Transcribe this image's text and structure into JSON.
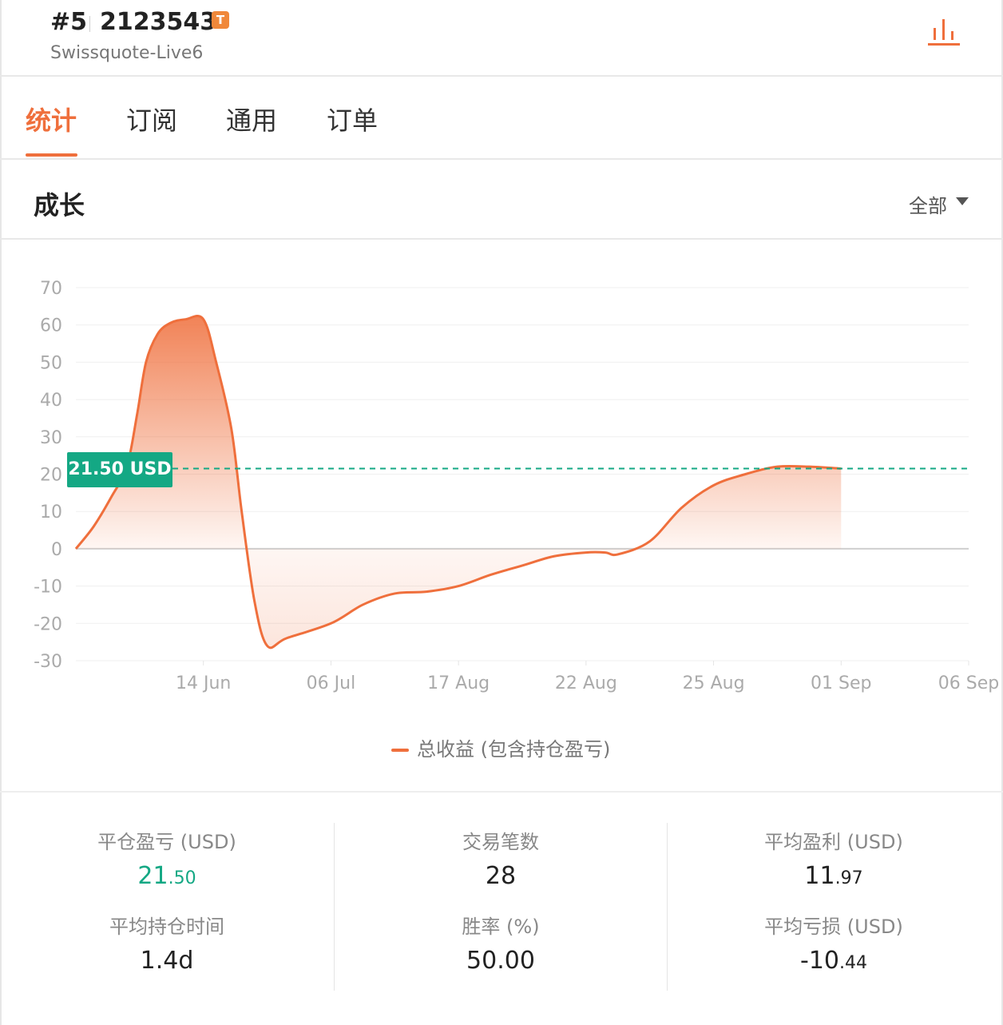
{
  "header": {
    "rank": "#5",
    "account_id": "2123543",
    "badge": "T",
    "server": "Swissquote-Live6",
    "icon": "bar-chart-icon"
  },
  "tabs": [
    {
      "label": "统计",
      "active": true
    },
    {
      "label": "订阅",
      "active": false
    },
    {
      "label": "通用",
      "active": false
    },
    {
      "label": "订单",
      "active": false
    }
  ],
  "section": {
    "title": "成长",
    "filter_label": "全部"
  },
  "colors": {
    "accent": "#ef6f3c",
    "positive": "#14a884"
  },
  "chart_data": {
    "type": "area",
    "series": [
      {
        "name": "总收益 (包含持仓盈亏)",
        "points": [
          [
            0,
            0
          ],
          [
            0.14,
            6
          ],
          [
            0.28,
            14
          ],
          [
            0.4,
            22
          ],
          [
            0.48,
            36
          ],
          [
            0.55,
            50
          ],
          [
            0.64,
            57.5
          ],
          [
            0.74,
            60.5
          ],
          [
            0.86,
            61.5
          ],
          [
            1.0,
            61.5
          ],
          [
            1.1,
            50
          ],
          [
            1.22,
            32
          ],
          [
            1.3,
            10
          ],
          [
            1.4,
            -14
          ],
          [
            1.5,
            -26
          ],
          [
            1.65,
            -24
          ],
          [
            2.0,
            -20
          ],
          [
            2.25,
            -15
          ],
          [
            2.5,
            -12
          ],
          [
            2.75,
            -11.5
          ],
          [
            3.0,
            -10
          ],
          [
            3.25,
            -7
          ],
          [
            3.5,
            -4.5
          ],
          [
            3.75,
            -2
          ],
          [
            4.0,
            -1
          ],
          [
            4.15,
            -1
          ],
          [
            4.25,
            -1.5
          ],
          [
            4.5,
            2
          ],
          [
            4.75,
            11
          ],
          [
            5.0,
            17
          ],
          [
            5.25,
            20
          ],
          [
            5.5,
            22
          ],
          [
            5.75,
            22
          ],
          [
            6.0,
            21.5
          ]
        ]
      }
    ],
    "x_tick_labels": [
      "14 Jun",
      "06 Jul",
      "17 Aug",
      "22 Aug",
      "25 Aug",
      "01 Sep",
      "06 Sep"
    ],
    "y_ticks": [
      70,
      60,
      50,
      40,
      30,
      20,
      10,
      0,
      -10,
      -20,
      -30
    ],
    "ylim": [
      -30,
      70
    ],
    "current_value": 21.5,
    "current_label": "21.50 USD",
    "grid": true,
    "legend_position": "bottom-center"
  },
  "stats": {
    "closed_pnl": {
      "label": "平仓盈亏 (USD)",
      "int": "21",
      "dec": ".50"
    },
    "trades": {
      "label": "交易笔数",
      "value": "28"
    },
    "avg_profit": {
      "label": "平均盈利 (USD)",
      "int": "11",
      "dec": ".97"
    },
    "avg_hold": {
      "label": "平均持仓时间",
      "value": "1.4d"
    },
    "win_rate": {
      "label": "胜率 (%)",
      "value": "50.00"
    },
    "avg_loss": {
      "label": "平均亏损 (USD)",
      "int": "-10",
      "dec": ".44"
    }
  }
}
